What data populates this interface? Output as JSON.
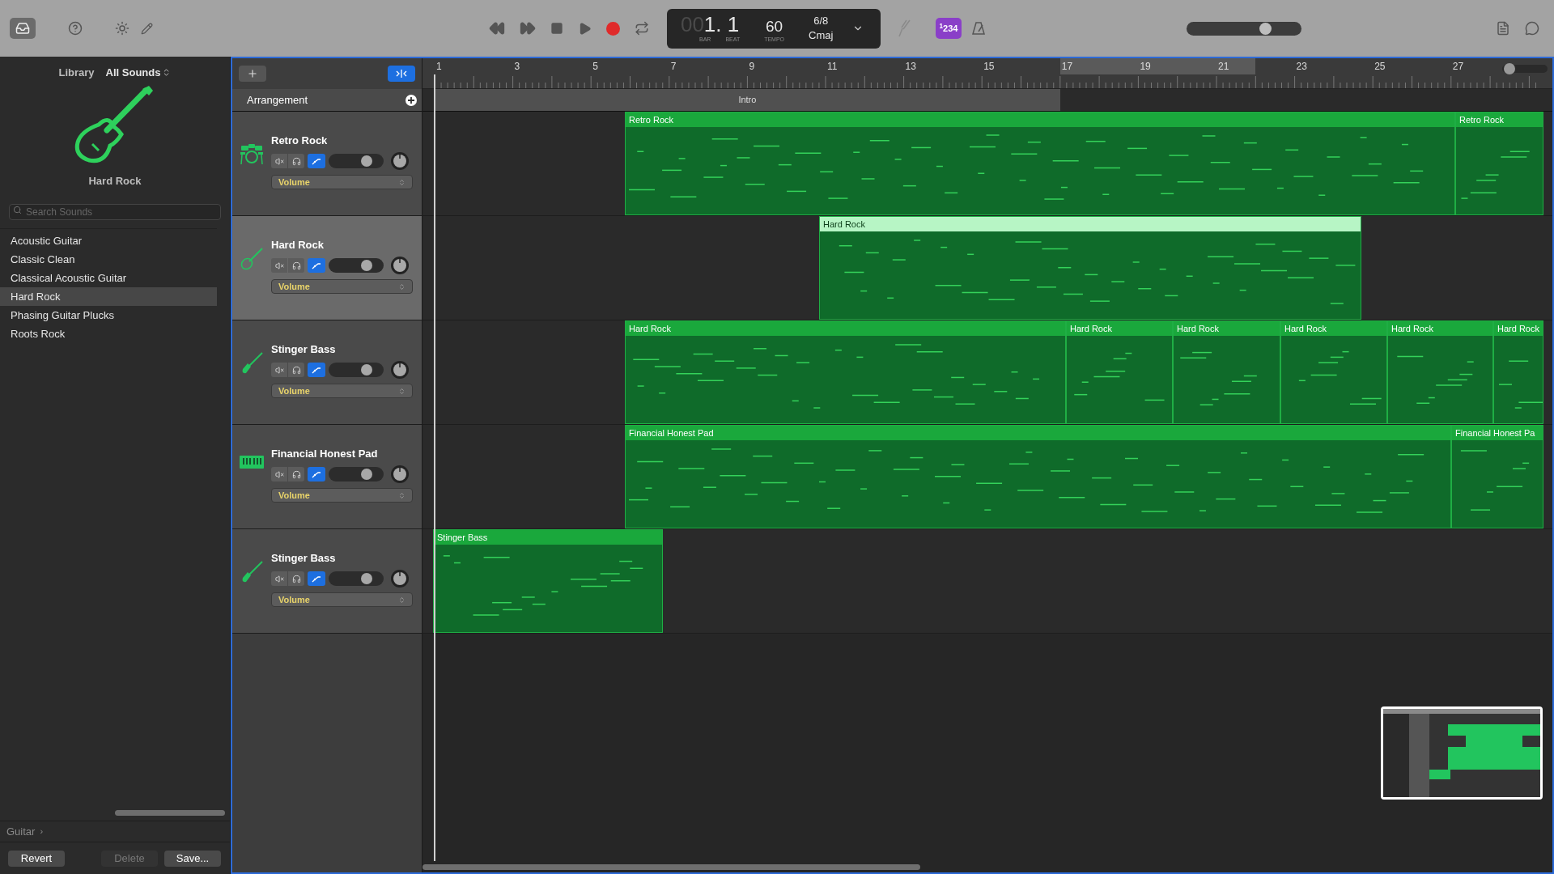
{
  "toolbar": {
    "library_button": {
      "selected": true
    },
    "lcd": {
      "bar_prefix": "00",
      "position": "1. 1",
      "bar_label": "BAR",
      "beat_label": "BEAT",
      "tempo": "60",
      "tempo_label": "TEMPO",
      "time_signature": "6/8",
      "key": "Cmaj"
    },
    "count_in": {
      "label": "$^{1}$234",
      "on": true
    },
    "master_volume": {
      "level": 0.68
    }
  },
  "library": {
    "title": "Library",
    "filter": "All Sounds",
    "patch_name": "Hard Rock",
    "search": {
      "placeholder": "Search Sounds"
    },
    "items": [
      {
        "label": "Acoustic Guitar",
        "selected": false
      },
      {
        "label": "Classic Clean",
        "selected": false
      },
      {
        "label": "Classical Acoustic Guitar",
        "selected": false
      },
      {
        "label": "Hard Rock",
        "selected": true
      },
      {
        "label": "Phasing Guitar Plucks",
        "selected": false
      },
      {
        "label": "Roots Rock",
        "selected": false
      }
    ],
    "breadcrumb": "Guitar",
    "breadcrumb_arrow": "›",
    "buttons": [
      {
        "label": "Revert",
        "disabled": false
      },
      {
        "label": "Delete",
        "disabled": true
      },
      {
        "label": "Save...",
        "disabled": false
      }
    ]
  },
  "ruler": {
    "zoom": {
      "level": 0.1
    },
    "bars": [
      "1",
      "3",
      "5",
      "7",
      "9",
      "11",
      "13",
      "15",
      "17",
      "19",
      "21",
      "23",
      "25",
      "27"
    ]
  },
  "arrangement": {
    "label": "Arrangement",
    "sections": [
      {
        "label": "Intro"
      }
    ]
  },
  "tracks": [
    {
      "name": "Retro Rock",
      "kind": "drums",
      "selected": false,
      "muted": false,
      "solo": false,
      "volume": {
        "level": 0.72
      },
      "automation": "Volume",
      "regions": [
        {
          "label": "Retro Rock",
          "selected": false
        },
        {
          "label": "Retro Rock",
          "selected": false
        }
      ]
    },
    {
      "name": "Hard Rock",
      "kind": "guitar",
      "selected": true,
      "muted": false,
      "solo": false,
      "volume": {
        "level": 0.72
      },
      "automation": "Volume",
      "regions": [
        {
          "label": "Hard Rock",
          "selected": true
        }
      ]
    },
    {
      "name": "Stinger Bass",
      "kind": "bass",
      "selected": false,
      "muted": false,
      "solo": false,
      "volume": {
        "level": 0.72
      },
      "automation": "Volume",
      "regions": [
        {
          "label": "Hard Rock",
          "selected": false
        },
        {
          "label": "Hard Rock",
          "selected": false
        },
        {
          "label": "Hard Rock",
          "selected": false
        },
        {
          "label": "Hard Rock",
          "selected": false
        },
        {
          "label": "Hard Rock",
          "selected": false
        },
        {
          "label": "Hard Rock",
          "selected": false
        }
      ]
    },
    {
      "name": "Financial Honest Pad",
      "kind": "keyboard",
      "selected": false,
      "muted": false,
      "solo": false,
      "volume": {
        "level": 0.72
      },
      "automation": "Volume",
      "regions": [
        {
          "label": "Financial Honest Pad",
          "selected": false
        },
        {
          "label": "Financial Honest Pa",
          "selected": false
        }
      ]
    },
    {
      "name": "Stinger Bass",
      "kind": "bass",
      "selected": false,
      "muted": false,
      "solo": false,
      "volume": {
        "level": 0.72
      },
      "automation": "Volume",
      "regions": [
        {
          "label": "Stinger Bass",
          "selected": false
        }
      ]
    }
  ]
}
